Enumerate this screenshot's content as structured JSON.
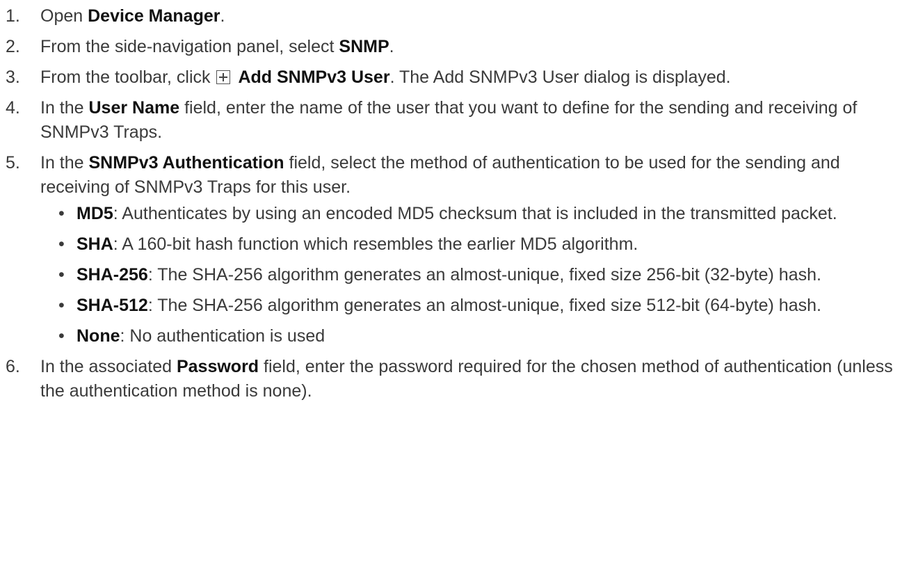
{
  "steps": [
    {
      "number": "1.",
      "parts": [
        "Open ",
        "Device Manager",
        "."
      ]
    },
    {
      "number": "2.",
      "parts": [
        "From the side-navigation panel, select ",
        "SNMP",
        "."
      ]
    },
    {
      "number": "3.",
      "parts": [
        "From the toolbar, click ",
        "Add SNMPv3 User",
        ". The Add SNMPv3 User dialog is displayed."
      ]
    },
    {
      "number": "4.",
      "parts": [
        "In the ",
        "User Name",
        " field, enter the name of the user that you want to define for the sending and receiving of SNMPv3 Traps."
      ]
    },
    {
      "number": "5.",
      "parts": [
        "In the ",
        "SNMPv3 Authentication",
        " field, select the method of authentication to be used for the sending and receiving of SNMPv3 Traps for this user."
      ],
      "subitems": [
        {
          "term": "MD5",
          "text": ": Authenticates by using an encoded MD5 checksum that is included in the transmitted packet."
        },
        {
          "term": "SHA",
          "text": ": A 160-bit hash function which resembles the earlier MD5 algorithm."
        },
        {
          "term": "SHA-256",
          "text": ": The SHA-256 algorithm generates an almost-unique, fixed size 256-bit (32-byte) hash."
        },
        {
          "term": "SHA-512",
          "text": ": The SHA-256 algorithm generates an almost-unique, fixed size 512-bit (64-byte) hash."
        },
        {
          "term": "None",
          "text": ": No authentication is used"
        }
      ]
    },
    {
      "number": "6.",
      "parts": [
        "In the associated ",
        "Password",
        " field, enter the password required for the chosen method of authentication (unless the authentication method is none)."
      ]
    }
  ],
  "icons": {
    "add_icon": "plus-square-icon"
  }
}
